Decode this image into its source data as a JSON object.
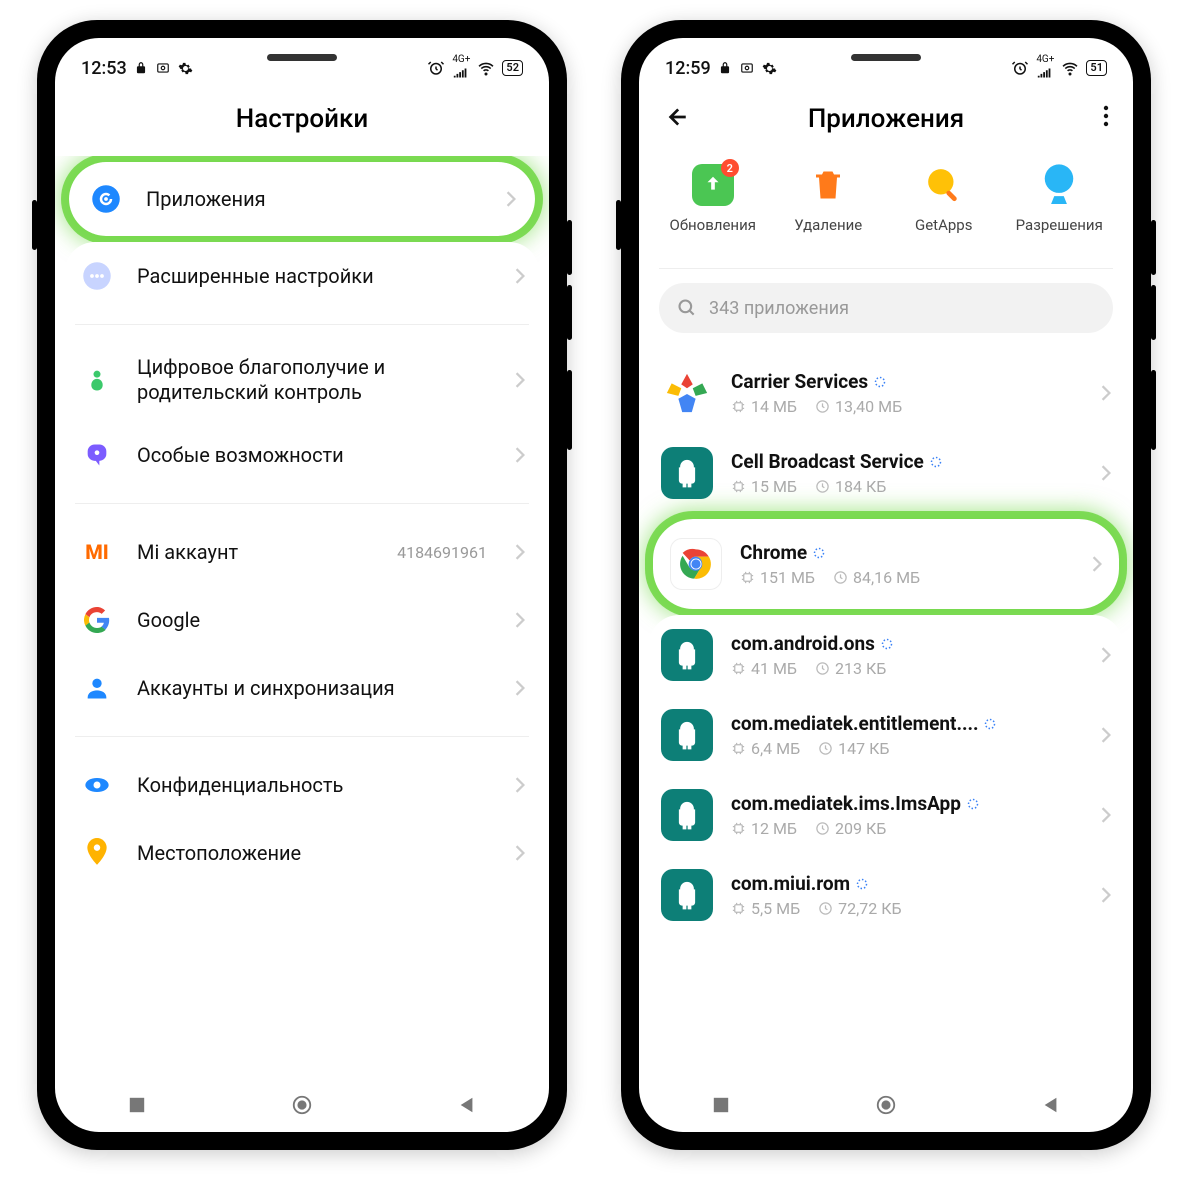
{
  "phone1": {
    "status": {
      "time": "12:53",
      "battery": "52"
    },
    "title": "Настройки",
    "rows": [
      {
        "label": "Приложения",
        "highlighted": true
      },
      {
        "label": "Расширенные настройки"
      },
      {
        "label": "Цифровое благополучие и родительский контроль"
      },
      {
        "label": "Особые возможности"
      },
      {
        "label": "Mi аккаунт",
        "value": "4184691961"
      },
      {
        "label": "Google"
      },
      {
        "label": "Аккаунты и синхронизация"
      },
      {
        "label": "Конфиденциальность"
      },
      {
        "label": "Местоположение"
      }
    ]
  },
  "phone2": {
    "status": {
      "time": "12:59",
      "battery": "51"
    },
    "title": "Приложения",
    "actions": [
      {
        "label": "Обновления",
        "badge": "2"
      },
      {
        "label": "Удаление"
      },
      {
        "label": "GetApps"
      },
      {
        "label": "Разрешения"
      }
    ],
    "search": {
      "placeholder": "343 приложения"
    },
    "apps": [
      {
        "name": "Carrier Services",
        "size": "14 МБ",
        "data": "13,40 МБ",
        "highlighted": false,
        "icon": "play"
      },
      {
        "name": "Cell Broadcast Service",
        "size": "15 МБ",
        "data": "184 КБ",
        "highlighted": false,
        "icon": "android"
      },
      {
        "name": "Chrome",
        "size": "151 МБ",
        "data": "84,16 МБ",
        "highlighted": true,
        "icon": "chrome"
      },
      {
        "name": "com.android.ons",
        "size": "41 МБ",
        "data": "213 КБ",
        "highlighted": false,
        "icon": "android"
      },
      {
        "name": "com.mediatek.entitlement....",
        "size": "6,4 МБ",
        "data": "147 КБ",
        "highlighted": false,
        "icon": "android"
      },
      {
        "name": "com.mediatek.ims.ImsApp",
        "size": "12 МБ",
        "data": "209 КБ",
        "highlighted": false,
        "icon": "android"
      },
      {
        "name": "com.miui.rom",
        "size": "5,5 МБ",
        "data": "72,72 КБ",
        "highlighted": false,
        "icon": "android"
      }
    ]
  }
}
